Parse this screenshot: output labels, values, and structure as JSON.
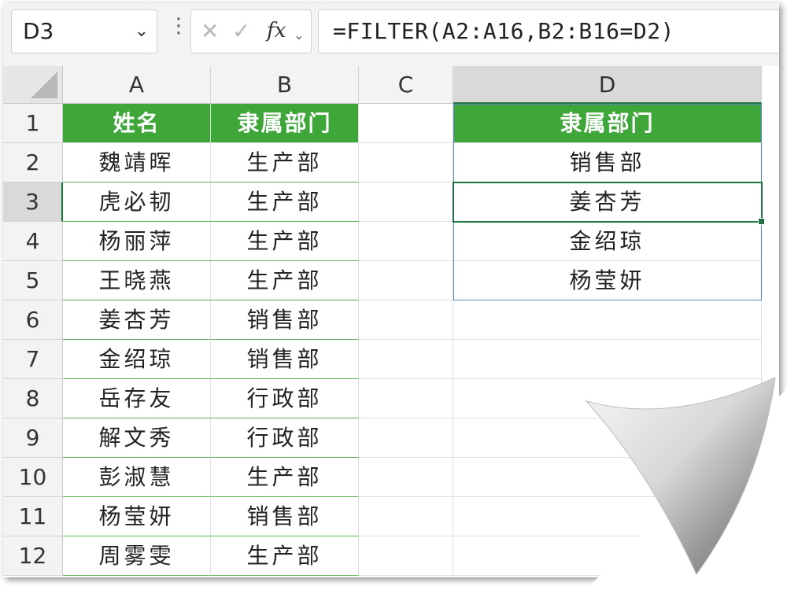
{
  "formula_bar": {
    "name_box": "D3",
    "formula": "=FILTER(A2:A16,B2:B16=D2)"
  },
  "icons": {
    "name_dropdown": "chevron-down-icon",
    "more": "vertical-dots-icon",
    "cancel": "cancel-x-icon",
    "enter": "checkmark-icon",
    "function": "fx-icon"
  },
  "colors": {
    "header_green": "#3fa63a",
    "excel_green": "#217346",
    "table_blue": "#5b86c6"
  },
  "columns": [
    "A",
    "B",
    "C",
    "D"
  ],
  "rows": [
    "1",
    "2",
    "3",
    "4",
    "5",
    "6",
    "7",
    "8",
    "9",
    "10",
    "11",
    "12"
  ],
  "table_a": {
    "headers": [
      "姓名",
      "隶属部门"
    ],
    "rows": [
      [
        "魏靖晖",
        "生产部"
      ],
      [
        "虎必韧",
        "生产部"
      ],
      [
        "杨丽萍",
        "生产部"
      ],
      [
        "王晓燕",
        "生产部"
      ],
      [
        "姜杏芳",
        "销售部"
      ],
      [
        "金绍琼",
        "销售部"
      ],
      [
        "岳存友",
        "行政部"
      ],
      [
        "解文秀",
        "行政部"
      ],
      [
        "彭淑慧",
        "生产部"
      ],
      [
        "杨莹妍",
        "销售部"
      ],
      [
        "周雾雯",
        "生产部"
      ]
    ]
  },
  "table_d": {
    "header": "隶属部门",
    "criteria": "销售部",
    "results": [
      "姜杏芳",
      "金绍琼",
      "杨莹妍"
    ]
  }
}
